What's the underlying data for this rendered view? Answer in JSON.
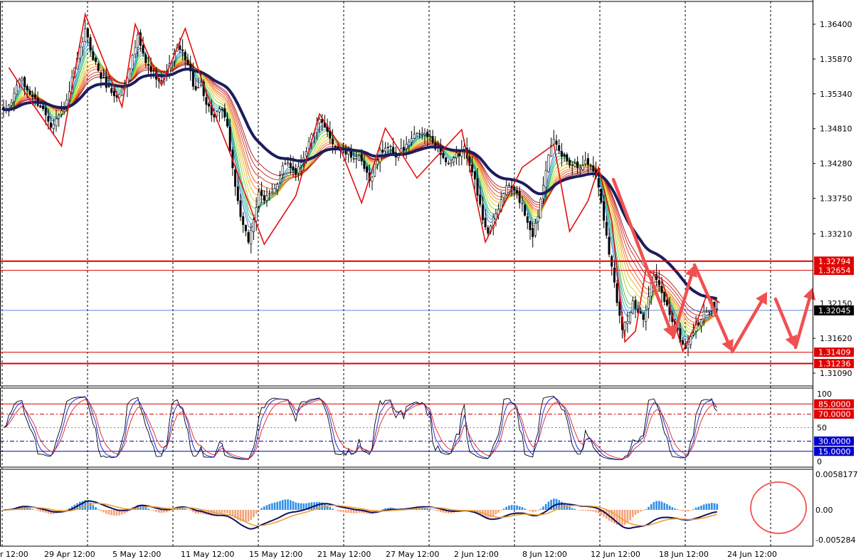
{
  "chart_data": [
    {
      "type": "candlestick",
      "panel": "price",
      "x_labels": [
        "r 12:00",
        "29 Apr 12:00",
        "5 May 12:00",
        "11 May 12:00",
        "15 May 12:00",
        "21 May 12:00",
        "27 May 12:00",
        "2 Jun 12:00",
        "8 Jun 12:00",
        "12 Jun 12:00",
        "18 Jun 12:00",
        "24 Jun 12:00"
      ],
      "y_ticks": [
        "1.36400",
        "1.35870",
        "1.35340",
        "1.34810",
        "1.34280",
        "1.33750",
        "1.33210",
        "1.31620",
        "1.31090"
      ],
      "ylim": [
        1.3096,
        1.367
      ],
      "price_tag": {
        "label": "1.32150",
        "value": 1.3215
      },
      "current_price": {
        "label": "1.32045",
        "value": 1.32045
      },
      "horizontal_levels": [
        {
          "label": "1.32794",
          "value": 1.32794
        },
        {
          "label": "1.32654",
          "value": 1.32654
        },
        {
          "label": "1.31409",
          "value": 1.31409
        },
        {
          "label": "1.31236",
          "value": 1.31236
        }
      ],
      "close_path": [
        [
          0,
          1.3505
        ],
        [
          3,
          1.3522
        ],
        [
          6,
          1.3558
        ],
        [
          9,
          1.354
        ],
        [
          12,
          1.3525
        ],
        [
          15,
          1.351
        ],
        [
          18,
          1.3488
        ],
        [
          21,
          1.35
        ],
        [
          24,
          1.352
        ],
        [
          26,
          1.3555
        ],
        [
          29,
          1.36
        ],
        [
          31,
          1.363
        ],
        [
          34,
          1.359
        ],
        [
          37,
          1.356
        ],
        [
          40,
          1.3542
        ],
        [
          43,
          1.3528
        ],
        [
          46,
          1.3548
        ],
        [
          49,
          1.359
        ],
        [
          51,
          1.362
        ],
        [
          54,
          1.358
        ],
        [
          57,
          1.3565
        ],
        [
          60,
          1.3555
        ],
        [
          63,
          1.3575
        ],
        [
          66,
          1.3605
        ],
        [
          69,
          1.359
        ],
        [
          71,
          1.3565
        ],
        [
          73,
          1.3535
        ],
        [
          75,
          1.3552
        ],
        [
          77,
          1.352
        ],
        [
          80,
          1.3498
        ],
        [
          83,
          1.351
        ],
        [
          85,
          1.348
        ],
        [
          87,
          1.342
        ],
        [
          89,
          1.337
        ],
        [
          91,
          1.333
        ],
        [
          93,
          1.331
        ],
        [
          95,
          1.3345
        ],
        [
          97,
          1.338
        ],
        [
          99,
          1.337
        ],
        [
          101,
          1.3385
        ],
        [
          104,
          1.3395
        ],
        [
          106,
          1.342
        ],
        [
          108,
          1.343
        ],
        [
          111,
          1.3415
        ],
        [
          114,
          1.344
        ],
        [
          117,
          1.347
        ],
        [
          120,
          1.3492
        ],
        [
          123,
          1.3475
        ],
        [
          126,
          1.3455
        ],
        [
          129,
          1.3445
        ],
        [
          132,
          1.344
        ],
        [
          135,
          1.3435
        ],
        [
          137,
          1.342
        ],
        [
          139,
          1.34
        ],
        [
          141,
          1.3425
        ],
        [
          143,
          1.3445
        ],
        [
          146,
          1.3455
        ],
        [
          149,
          1.344
        ],
        [
          152,
          1.345
        ],
        [
          155,
          1.3465
        ],
        [
          158,
          1.3475
        ],
        [
          161,
          1.347
        ],
        [
          164,
          1.3455
        ],
        [
          166,
          1.3445
        ],
        [
          168,
          1.343
        ],
        [
          170,
          1.3425
        ],
        [
          172,
          1.344
        ],
        [
          175,
          1.345
        ],
        [
          178,
          1.342
        ],
        [
          180,
          1.338
        ],
        [
          182,
          1.3345
        ],
        [
          184,
          1.3325
        ],
        [
          186,
          1.334
        ],
        [
          188,
          1.336
        ],
        [
          190,
          1.3385
        ],
        [
          192,
          1.3395
        ],
        [
          195,
          1.338
        ],
        [
          197,
          1.3365
        ],
        [
          199,
          1.334
        ],
        [
          201,
          1.332
        ],
        [
          203,
          1.335
        ],
        [
          205,
          1.34
        ],
        [
          207,
          1.3445
        ],
        [
          209,
          1.346
        ],
        [
          212,
          1.344
        ],
        [
          215,
          1.343
        ],
        [
          218,
          1.3425
        ],
        [
          221,
          1.343
        ],
        [
          223,
          1.3425
        ],
        [
          225,
          1.341
        ],
        [
          227,
          1.337
        ],
        [
          229,
          1.332
        ],
        [
          231,
          1.327
        ],
        [
          233,
          1.322
        ],
        [
          235,
          1.318
        ],
        [
          237,
          1.319
        ],
        [
          239,
          1.3215
        ],
        [
          241,
          1.32
        ],
        [
          243,
          1.319
        ],
        [
          245,
          1.323
        ],
        [
          247,
          1.3258
        ],
        [
          249,
          1.324
        ],
        [
          251,
          1.322
        ],
        [
          253,
          1.32
        ],
        [
          255,
          1.318
        ],
        [
          257,
          1.316
        ],
        [
          259,
          1.3145
        ],
        [
          261,
          1.3165
        ],
        [
          263,
          1.318
        ],
        [
          265,
          1.3192
        ],
        [
          267,
          1.3205
        ],
        [
          269,
          1.3212
        ],
        [
          271,
          1.3204
        ]
      ]
    },
    {
      "type": "line",
      "panel": "oscillator",
      "y_ticks": [
        "100",
        "50",
        "0"
      ],
      "levels": [
        {
          "label": "85.0000",
          "value": 85
        },
        {
          "label": "70.0000",
          "value": 70
        },
        {
          "label": "30.0000",
          "value": 30
        },
        {
          "label": "15.0000",
          "value": 15
        }
      ],
      "ylim": [
        0,
        100
      ]
    },
    {
      "type": "bar",
      "panel": "macd",
      "y_ticks": [
        "0.0058177",
        "0.00",
        "-0.005284"
      ],
      "ylim": [
        -0.005284,
        0.0058177
      ],
      "zero": 0.0
    }
  ]
}
